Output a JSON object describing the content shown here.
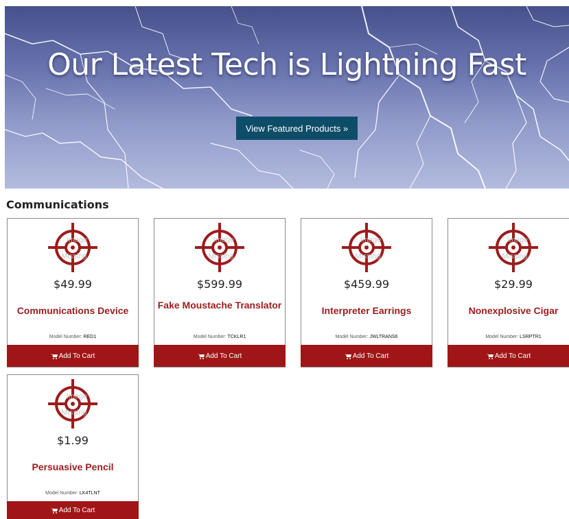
{
  "hero": {
    "title": "Our Latest Tech is Lightning Fast",
    "button_label": "View Featured Products »"
  },
  "section": {
    "title": "Communications"
  },
  "image_placeholder": {
    "icon": "target-icon",
    "text_top": "Image",
    "text_bottom": "Missing"
  },
  "products": [
    {
      "price": "$49.99",
      "name": "Communications Device",
      "model_label": "Model Number:",
      "model": "RED1",
      "cart_label": "Add To Cart"
    },
    {
      "price": "$599.99",
      "name": "Fake Moustache Translator",
      "model_label": "Model Number:",
      "model": "TCKLR1",
      "cart_label": "Add To Cart"
    },
    {
      "price": "$459.99",
      "name": "Interpreter Earrings",
      "model_label": "Model Number:",
      "model": "JWLTRANS6",
      "cart_label": "Add To Cart"
    },
    {
      "price": "$29.99",
      "name": "Nonexplosive Cigar",
      "model_label": "Model Number:",
      "model": "LSRPTR1",
      "cart_label": "Add To Cart"
    },
    {
      "price": "$1.99",
      "name": "Persuasive Pencil",
      "model_label": "Model Number:",
      "model": "LK4TLNT",
      "cart_label": "Add To Cart"
    }
  ],
  "colors": {
    "accent_red": "#a01616",
    "hero_button": "#0e4d68",
    "product_name": "#9c1c1c"
  }
}
